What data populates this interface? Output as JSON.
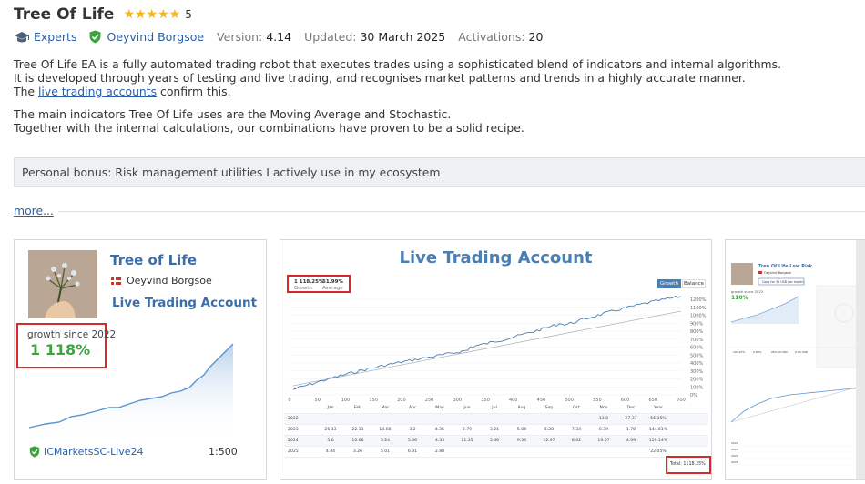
{
  "product": {
    "title": "Tree Of Life",
    "stars": "★★★★★",
    "rating": "5"
  },
  "meta": {
    "category": "Experts",
    "author": "Oeyvind Borgsoe",
    "version_label": "Version:",
    "version": "4.14",
    "updated_label": "Updated:",
    "updated": "30 March 2025",
    "activations_label": "Activations:",
    "activations": "20"
  },
  "description": {
    "line1": "Tree Of Life EA is a fully automated trading robot that executes trades using a sophisticated blend of indicators and internal algorithms.",
    "line2": "It is developed through years of testing and live trading, and recognises market patterns and trends in a highly accurate manner.",
    "line3_pre": "The ",
    "line3_link": "live trading accounts",
    "line3_post": " confirm this.",
    "line4": "The main indicators Tree Of Life uses are the Moving Average and Stochastic.",
    "line5": "Together with the internal calculations, our combinations have proven to be a solid recipe."
  },
  "bonus": "Personal bonus: Risk management utilities I actively use in my ecosystem",
  "more_link": "more...",
  "card1": {
    "title": "Tree of Life",
    "owner": "Oeyvind Borgsoe",
    "subtitle": "Live Trading Account",
    "growth_label": "growth since 2022",
    "growth_value": "1 118%",
    "broker": "ICMarketsSC-Live24",
    "leverage": "1:500"
  },
  "card2": {
    "title": "Live Trading Account",
    "stat1_value": "1 118.25%",
    "stat1_label": "Growth",
    "stat2_value": "51.99%",
    "stat2_label": "Average",
    "btn_growth": "Growth",
    "btn_balance": "Balance",
    "y_ticks": [
      "0%",
      "100%",
      "200%",
      "300%",
      "400%",
      "500%",
      "600%",
      "700%",
      "800%",
      "900%",
      "1000%",
      "1100%",
      "1200%"
    ],
    "x_ticks": [
      "0",
      "50",
      "100",
      "150",
      "200",
      "250",
      "300",
      "350",
      "400",
      "450",
      "500",
      "550",
      "600",
      "650",
      "700"
    ],
    "table_header": [
      "",
      "Jan",
      "Feb",
      "Mar",
      "Apr",
      "May",
      "Jun",
      "Jul",
      "Aug",
      "Sep",
      "Oct",
      "Nov",
      "Dec",
      "Year"
    ],
    "table_rows": [
      [
        "2022",
        "",
        "",
        "",
        "",
        "",
        "",
        "",
        "",
        "",
        "",
        "13.8",
        "27.37",
        "56.35%"
      ],
      [
        "2023",
        "26.13",
        "22.13",
        "14.68",
        "3.2",
        "4.35",
        "2.79",
        "3.21",
        "5.04",
        "5.28",
        "7.34",
        "0.39",
        "1.78",
        "144.61%"
      ],
      [
        "2024",
        "5.6",
        "10.66",
        "3.24",
        "5.36",
        "4.33",
        "11.35",
        "5.46",
        "9.34",
        "12.97",
        "8.62",
        "19.07",
        "4.99",
        "159.14%"
      ],
      [
        "2025",
        "4.44",
        "3.26",
        "5.01",
        "6.31",
        "2.88",
        "",
        "",
        "",
        "",
        "",
        "",
        "",
        "22.05%"
      ]
    ],
    "total": "Total: 1118.25%"
  },
  "card3": {
    "title": "Tree Of Life Low Risk",
    "owner": "Oeyvind Borgsoe",
    "subscribe": "Copy for 30 USD per month",
    "growth_label": "growth since 2022",
    "growth_value": "110%"
  },
  "colors": {
    "accent": "#2a5fa7",
    "title_blue": "#3b6ea8",
    "growth_green": "#3aa53a",
    "highlight_red": "#d42a2a",
    "star": "#f2b91b"
  }
}
